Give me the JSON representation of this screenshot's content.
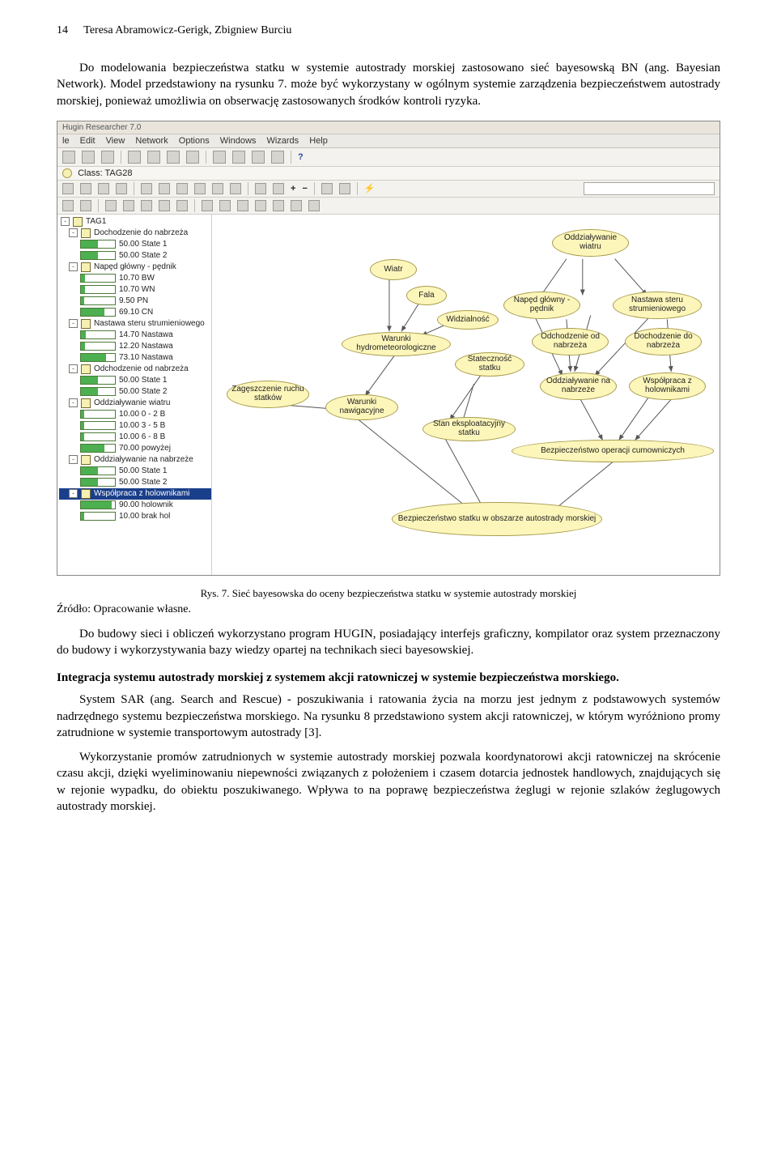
{
  "page_number": "14",
  "running_head": "Teresa Abramowicz-Gerigk, Zbigniew Burciu",
  "para1": "Do modelowania bezpieczeństwa statku w systemie autostrady morskiej zastosowano sieć bayesowską BN (ang. Bayesian Network). Model przedstawiony na rysunku 7. może być wykorzystany w ogólnym systemie zarządzenia bezpieczeństwem autostrady morskiej, ponieważ umożliwia on obserwację zastosowanych środków kontroli ryzyka.",
  "app": {
    "title_suffix": "Hugin Researcher 7.0",
    "menu": [
      "le",
      "Edit",
      "View",
      "Network",
      "Options",
      "Windows",
      "Wizards",
      "Help"
    ],
    "class_label": "Class: TAG28",
    "tree_root": "TAG1",
    "tree": [
      {
        "type": "node",
        "label": "Dochodzenie do nabrzeża",
        "children": [
          {
            "pct": 50,
            "label": "50.00 State 1"
          },
          {
            "pct": 50,
            "label": "50.00 State 2"
          }
        ]
      },
      {
        "type": "node",
        "label": "Napęd główny - pędnik",
        "children": [
          {
            "pct": 11,
            "label": "10.70 BW"
          },
          {
            "pct": 11,
            "label": "10.70 WN"
          },
          {
            "pct": 10,
            "label": "9.50 PN"
          },
          {
            "pct": 69,
            "label": "69.10 CN"
          }
        ]
      },
      {
        "type": "node",
        "label": "Nastawa steru strumieniowego",
        "children": [
          {
            "pct": 15,
            "label": "14.70 Nastawa"
          },
          {
            "pct": 12,
            "label": "12.20 Nastawa"
          },
          {
            "pct": 73,
            "label": "73.10 Nastawa"
          }
        ]
      },
      {
        "type": "node",
        "label": "Odchodzenie od nabrzeża",
        "children": [
          {
            "pct": 50,
            "label": "50.00 State 1"
          },
          {
            "pct": 50,
            "label": "50.00 State 2"
          }
        ]
      },
      {
        "type": "node",
        "label": "Oddziaływanie wiatru",
        "children": [
          {
            "pct": 10,
            "label": "10.00 0 - 2 B"
          },
          {
            "pct": 10,
            "label": "10.00 3 - 5 B"
          },
          {
            "pct": 10,
            "label": "10.00 6 - 8 B"
          },
          {
            "pct": 70,
            "label": "70.00 powyżej"
          }
        ]
      },
      {
        "type": "node",
        "label": "Oddziaływanie na nabrzeże",
        "children": [
          {
            "pct": 50,
            "label": "50.00 State 1"
          },
          {
            "pct": 50,
            "label": "50.00 State 2"
          }
        ]
      },
      {
        "type": "node_sel",
        "label": "Współpraca z holownikami",
        "children": [
          {
            "pct": 90,
            "label": "90.00 holownik"
          },
          {
            "pct": 10,
            "label": "10.00 brak hol"
          }
        ]
      }
    ],
    "nodes": {
      "wiatr": "Wiatr",
      "fala": "Fala",
      "widz": "Widzialność",
      "warhyd": "Warunki\nhydrometeorologiczne",
      "zag": "Zagęszczenie\nruchu statków",
      "warnaw": "Warunki\nnawigacyjne",
      "stat": "Stateczność\nstatku",
      "stan": "Stan\neksploatacyjny statku",
      "oddzw": "Oddziaływanie\nwiatru",
      "naped": "Napęd główny\n- pędnik",
      "naster": "Nastawa steru\nstrumieniowego",
      "odch": "Odchodzenie\nod nabrzeża",
      "doch": "Dochodzenie\ndo nabrzeża",
      "oddzn": "Oddziaływanie\nna nabrzeże",
      "wspol": "Współpraca\nz holownikami",
      "bezpcum": "Bezpieczeństwo operacji cumowniczych",
      "bezpstat": "Bezpieczeństwo statku\nw obszarze autostrady morskiej"
    }
  },
  "fig_caption": "Rys. 7. Sieć bayesowska do oceny bezpieczeństwa statku w systemie autostrady morskiej",
  "fig_source": "Źródło: Opracowanie własne.",
  "para2": "Do budowy sieci i obliczeń wykorzystano program HUGIN, posiadający interfejs graficzny, kompilator oraz system przeznaczony do budowy i wykorzystywania bazy wiedzy opartej na technikach sieci bayesowskiej.",
  "section_heading": "Integracja systemu autostrady morskiej z systemem akcji ratowniczej w systemie bezpieczeństwa morskiego.",
  "para3": "System SAR (ang. Search and Rescue) - poszukiwania i ratowania życia na morzu jest jednym z podstawowych systemów nadrzędnego systemu bezpieczeństwa morskiego. Na rysunku 8 przedstawiono system akcji ratowniczej, w którym wyróżniono promy zatrudnione w systemie transportowym autostrady [3].",
  "para4": "Wykorzystanie promów zatrudnionych w systemie autostrady morskiej pozwala koordynatorowi akcji ratowniczej na skrócenie czasu akcji, dzięki wyeliminowaniu niepewności związanych z położeniem i czasem dotarcia jednostek handlowych, znajdujących się w rejonie wypadku, do obiektu poszukiwanego. Wpływa to na poprawę bezpieczeństwa żeglugi w rejonie szlaków żeglugowych autostrady morskiej."
}
